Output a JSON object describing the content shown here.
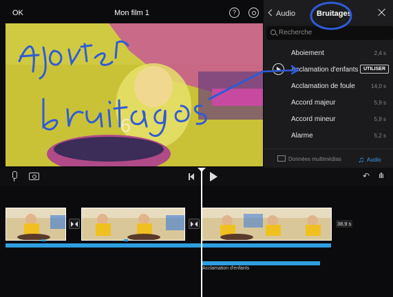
{
  "header": {
    "ok_label": "OK",
    "project_title": "Mon film 1",
    "help_label": "?"
  },
  "panel": {
    "back_label": "Audio",
    "title": "Bruitages",
    "search_placeholder": "Recherche",
    "sounds": [
      {
        "name": "Aboiement",
        "duration": "2,4 s"
      },
      {
        "name": "Acclamation d'enfants",
        "duration": "",
        "selected": true
      },
      {
        "name": "Acclamation de foule",
        "duration": "14,0 s"
      },
      {
        "name": "Accord majeur",
        "duration": "5,9 s"
      },
      {
        "name": "Accord mineur",
        "duration": "5,9 s"
      },
      {
        "name": "Alarme",
        "duration": "5,2 s"
      }
    ],
    "use_label": "UTILISER",
    "tabs": {
      "media_label": "Données multimédias",
      "audio_label": "Audio"
    }
  },
  "viewer": {
    "handwriting_line1": "Ajouter",
    "handwriting_line2": "bruitages",
    "accent_colors": {
      "ink": "#2f5bd6",
      "yellow": "#c9c237",
      "magenta": "#c74aa0"
    }
  },
  "timeline": {
    "clip_duration": "38,9 s",
    "sfx_clip_label": "Acclamation d'enfants",
    "accent_color": "#2d9fe0"
  }
}
